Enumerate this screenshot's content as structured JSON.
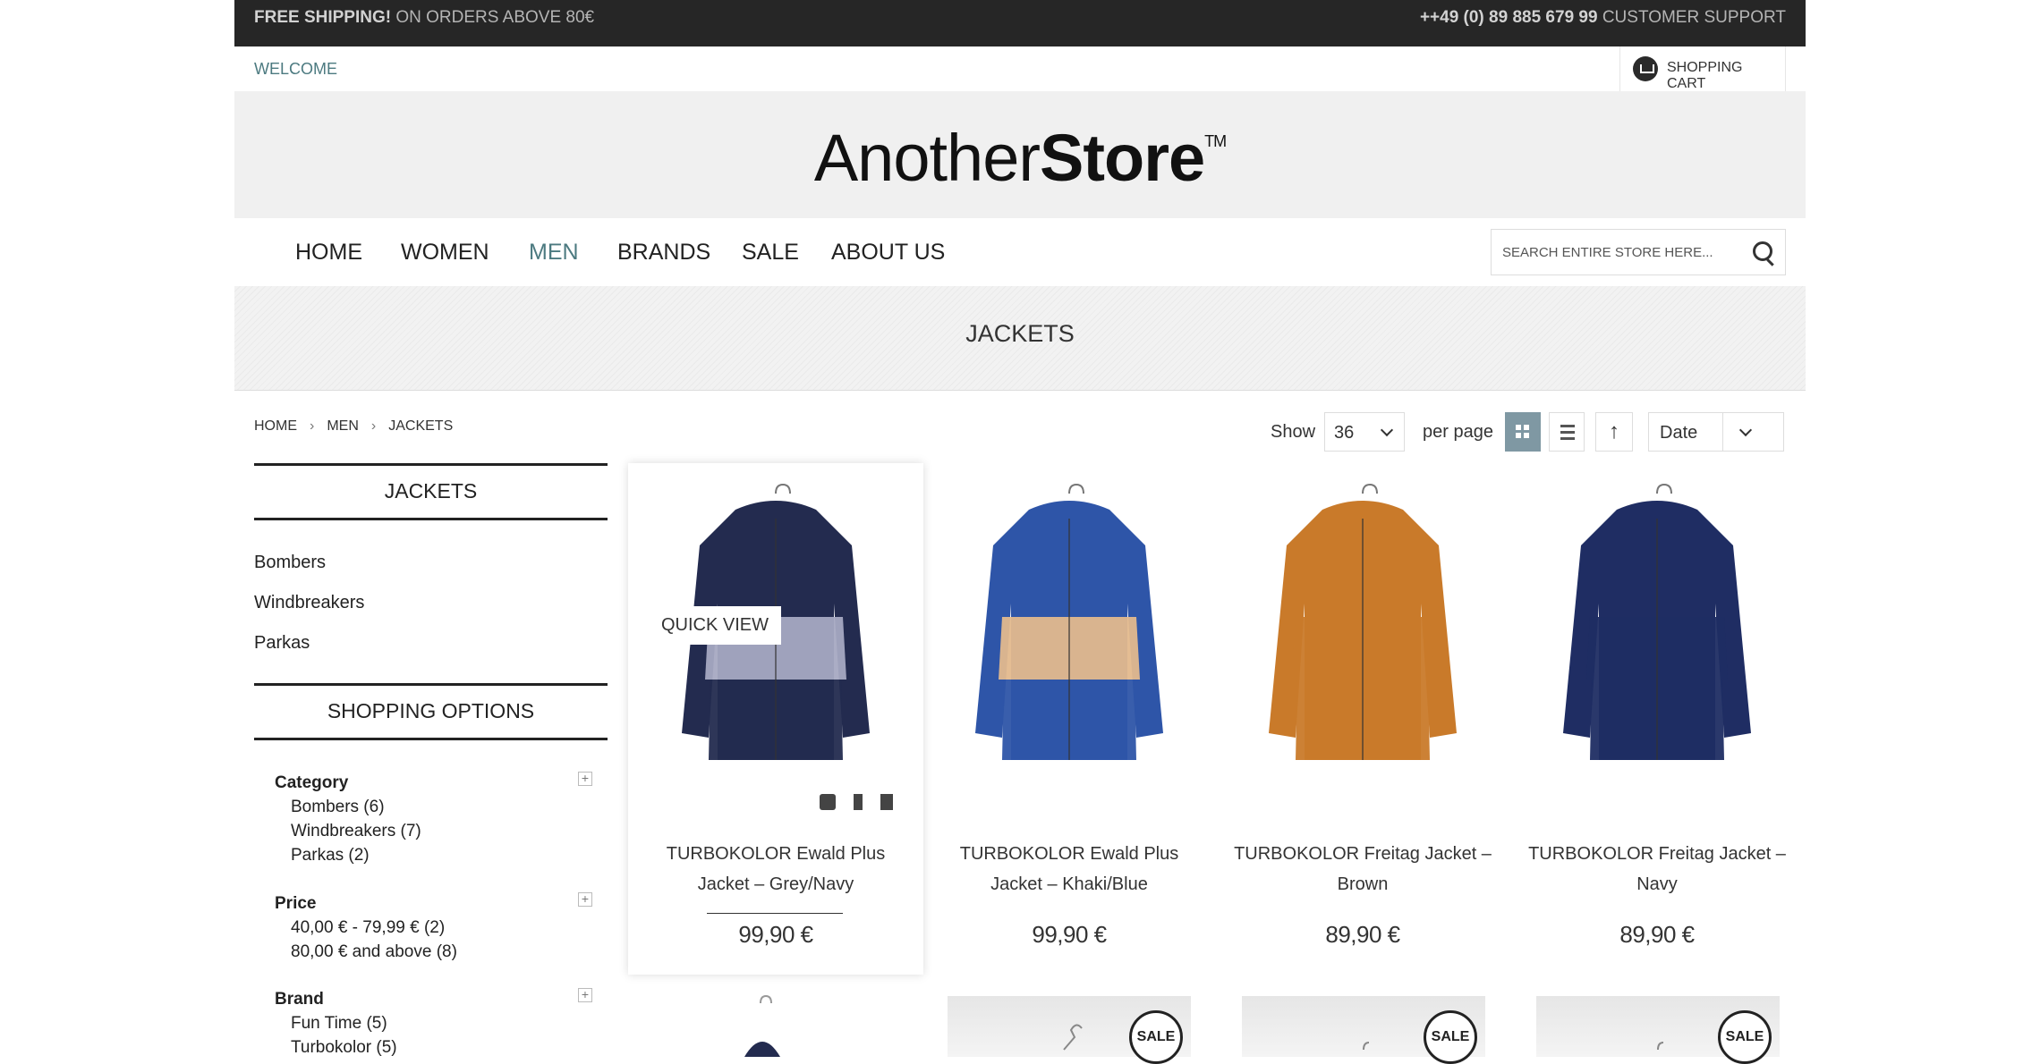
{
  "topbar": {
    "shipping_bold": "FREE SHIPPING!",
    "shipping_rest": " ON ORDERS ABOVE 80€",
    "phone": "++49 (0) 89 885 679 99",
    "support": " CUSTOMER SUPPORT"
  },
  "welcome": "WELCOME",
  "cart_label": "SHOPPING CART",
  "logo": {
    "thin": "Another",
    "bold": "Store",
    "tm": "TM"
  },
  "nav": [
    "HOME",
    "WOMEN",
    "MEN",
    "BRANDS",
    "SALE",
    "ABOUT US"
  ],
  "nav_active": "MEN",
  "search_placeholder": "SEARCH ENTIRE STORE HERE...",
  "page_title": "JACKETS",
  "breadcrumbs": [
    "HOME",
    "MEN",
    "JACKETS"
  ],
  "toolbar": {
    "show_label": "Show",
    "per_page_value": "36",
    "per_page_label": "per page",
    "sort_value": "Date",
    "sort_arrow": "↑"
  },
  "sidebar": {
    "category_title": "JACKETS",
    "categories": [
      "Bombers",
      "Windbreakers",
      "Parkas"
    ],
    "options_title": "SHOPPING OPTIONS",
    "groups": [
      {
        "label": "Category",
        "options": [
          "Bombers (6)",
          "Windbreakers (7)",
          "Parkas (2)"
        ]
      },
      {
        "label": "Price",
        "options": [
          "40,00 € - 79,99 € (2)",
          "80,00 € and above (8)"
        ]
      },
      {
        "label": "Brand",
        "options": [
          "Fun Time (5)",
          "Turbokolor (5)"
        ]
      }
    ],
    "plus": "+"
  },
  "products": [
    {
      "name_1": "TURBOKOLOR Ewald Plus",
      "name_2": "Jacket – Grey/Navy",
      "price": "99,90 €",
      "colors": [
        "#232b4f",
        "#a7a9c2",
        "#232b4f"
      ]
    },
    {
      "name_1": "TURBOKOLOR Ewald Plus",
      "name_2": "Jacket – Khaki/Blue",
      "price": "99,90 €",
      "colors": [
        "#2e55a8",
        "#e3b98d",
        "#2e55a8"
      ]
    },
    {
      "name_1": "TURBOKOLOR Freitag Jacket –",
      "name_2": "Brown",
      "price": "89,90 €",
      "colors": [
        "#c97a2a",
        "#c97a2a",
        "#c97a2a"
      ]
    },
    {
      "name_1": "TURBOKOLOR Freitag Jacket –",
      "name_2": "Navy",
      "price": "89,90 €",
      "colors": [
        "#1f2d63",
        "#1f2d63",
        "#1f2d63"
      ]
    }
  ],
  "quick_view": "QUICK VIEW",
  "sale_badge": "SALE"
}
